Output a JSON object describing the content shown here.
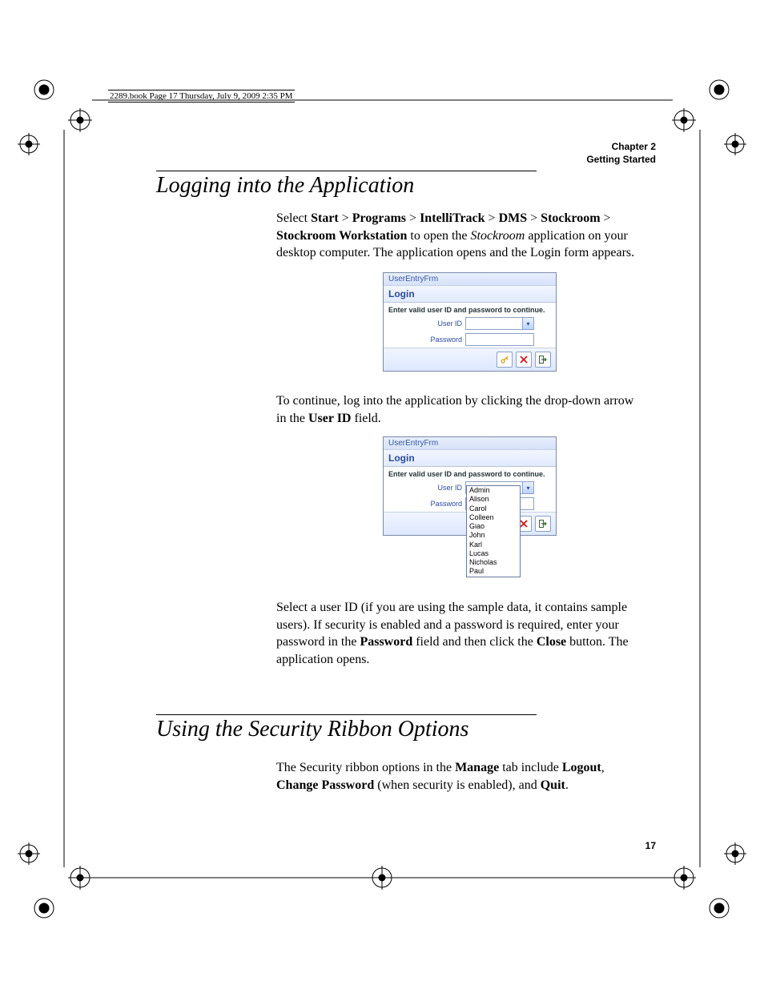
{
  "print_info": "2289.book  Page 17  Thursday, July 9, 2009  2:35 PM",
  "chapter": {
    "line1": "Chapter 2",
    "line2": "Getting Started"
  },
  "sections": {
    "s1": {
      "title": "Logging into the Application"
    },
    "s2": {
      "title": "Using the Security Ribbon Options"
    }
  },
  "paragraphs": {
    "p1": {
      "t1": "Select ",
      "b1": "Start",
      "gt1": " > ",
      "b2": "Programs",
      "gt2": " > ",
      "b3": "IntelliTrack",
      "gt3": " > ",
      "b4": "DMS",
      "gt4": " > ",
      "b5": "Stockroom",
      "gt5": " > ",
      "b6": "Stockroom Workstation",
      "t2": " to open the ",
      "i1": "Stockroom",
      "t3": " application on your desktop computer. The application opens and the Login form appears."
    },
    "p2": {
      "t1": "To continue, log into the application by clicking the drop-down arrow in the ",
      "b1": "User ID",
      "t2": " field."
    },
    "p3": {
      "t1": "Select a user ID (if you are using the sample data, it contains sample users). If security is enabled and a password is required, enter your password in the ",
      "b1": "Password",
      "t2": " field and then click the ",
      "b2": "Close",
      "t3": " button. The application opens."
    },
    "p4": {
      "t1": "The Security ribbon options in the ",
      "b1": "Manage",
      "t2": " tab include ",
      "b2": "Logout",
      "t3": ", ",
      "b3": "Change Password",
      "t4": " (when security is enabled), and ",
      "b4": "Quit",
      "t5": "."
    }
  },
  "login": {
    "frm_title": "UserEntryFrm",
    "heading": "Login",
    "instruction": "Enter valid user ID and password to continue.",
    "user_label": "User ID",
    "pwd_label": "Password",
    "users": [
      "Admin",
      "Alison",
      "Carol",
      "Colleen",
      "Giao",
      "John",
      "Karl",
      "Lucas",
      "Nicholas",
      "Paul"
    ]
  },
  "page_number": "17"
}
